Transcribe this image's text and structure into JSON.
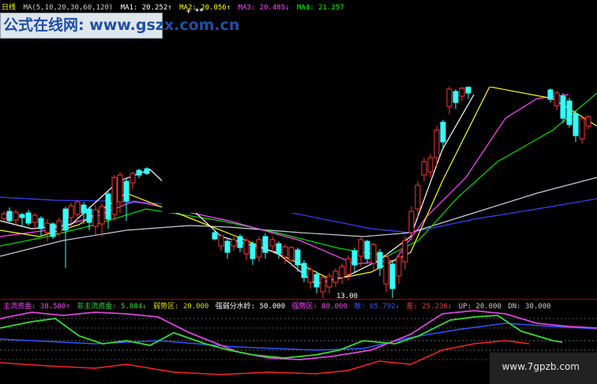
{
  "header": {
    "period": "日线",
    "ma_title": "MA(5,10,20,30,60,120)",
    "items": [
      {
        "text": "MA1: 20.252↑",
        "color": "#ffffff"
      },
      {
        "text": "MA2: 20.056↑",
        "color": "#ffff00"
      },
      {
        "text": "MA3: 20.485↓",
        "color": "#ff44ff"
      },
      {
        "text": "MA4: 21.257",
        "color": "#00ff00"
      }
    ],
    "plus_marks": "+ **"
  },
  "banner": "公式在线网: www.gszx.com.cn",
  "price_label": "13.00",
  "indicator": {
    "items": [
      {
        "text": "主流资金: 38.580↑",
        "color": "#ff44ff"
      },
      {
        "text": "非主流资金: 5.884↓",
        "color": "#33dd33"
      },
      {
        "text": "弱势区: 20.000",
        "color": "#dddd00"
      },
      {
        "text": "强弱分水岭: 50.000",
        "color": "#ffffff"
      },
      {
        "text": "强势区: 80.000",
        "color": "#ff44ff"
      },
      {
        "text": "散: 65.792↓",
        "color": "#3355ff"
      },
      {
        "text": "差: 25.236↓",
        "color": "#ff3333"
      },
      {
        "text": "UP: 20.000",
        "color": "#cccccc"
      },
      {
        "text": "DN: 30.000",
        "color": "#cccccc"
      }
    ]
  },
  "watermark": "www.7gpzb.com",
  "colors": {
    "background": "#000000",
    "bull_candle": "#ff3333",
    "bear_candle": "#33ffff",
    "ma5": "#ffffff",
    "ma10": "#ffff00",
    "ma20": "#ff44ff",
    "ma30": "#00dd00",
    "ma60": "#ccccdd",
    "ma120": "#3344ff",
    "panel_divider": "#b30000"
  }
}
